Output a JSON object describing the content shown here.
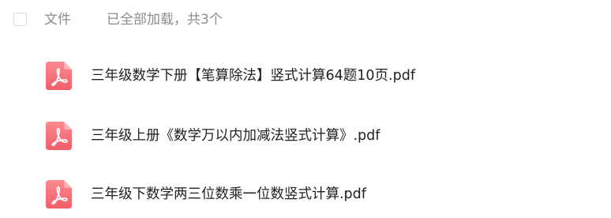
{
  "header": {
    "column_label": "文件",
    "status_text": "已全部加载，共3个"
  },
  "files": [
    {
      "name": "三年级数学下册【笔算除法】竖式计算64题10页.pdf",
      "icon": "pdf-file-icon"
    },
    {
      "name": "三年级上册《数学万以内加减法竖式计算》.pdf",
      "icon": "pdf-file-icon"
    },
    {
      "name": "三年级下数学两三位数乘一位数竖式计算.pdf",
      "icon": "pdf-file-icon"
    }
  ],
  "colors": {
    "pdf_icon": "#f5707a",
    "text_primary": "#1f1f1f",
    "text_secondary": "#8c8c8c",
    "checkbox_border": "#d9d9d9"
  }
}
